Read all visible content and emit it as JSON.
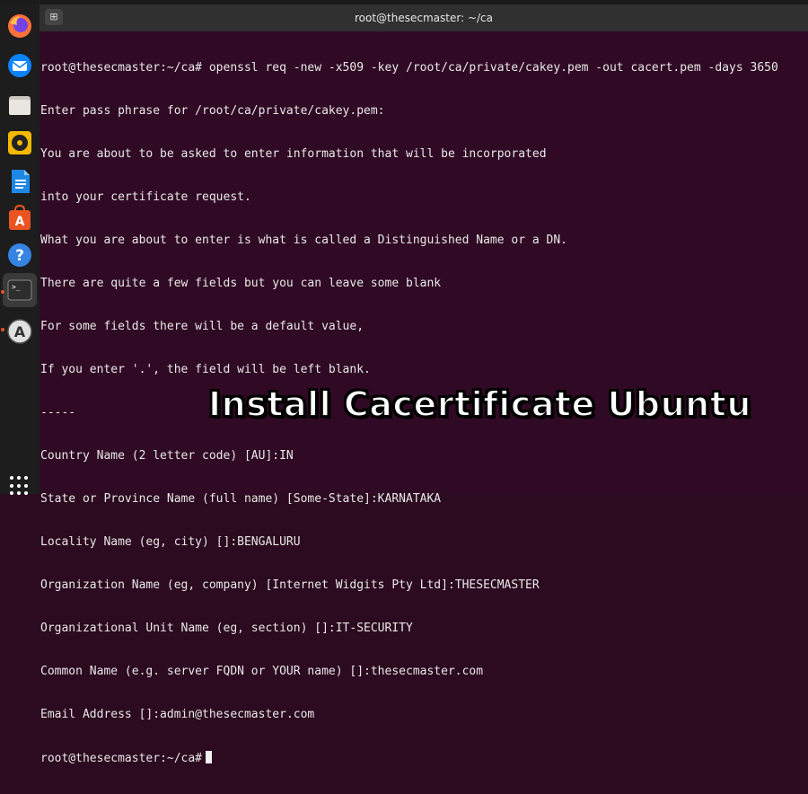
{
  "window": {
    "title": "root@thesecmaster: ~/ca",
    "new_tab_icon": "new-tab-icon"
  },
  "dock": {
    "items": [
      {
        "name": "firefox",
        "icon": "firefox-icon"
      },
      {
        "name": "thunderbird",
        "icon": "mail-icon"
      },
      {
        "name": "files",
        "icon": "folder-icon"
      },
      {
        "name": "rhythmbox",
        "icon": "music-icon"
      },
      {
        "name": "libreoffice-writer",
        "icon": "document-icon"
      },
      {
        "name": "software",
        "icon": "store-icon"
      },
      {
        "name": "help",
        "icon": "help-icon"
      },
      {
        "name": "terminal",
        "icon": "terminal-icon"
      },
      {
        "name": "updater",
        "icon": "update-icon"
      }
    ],
    "apps_grid_icon": "show-apps-icon",
    "accent_color": "#e95420"
  },
  "terminal": {
    "background": "#300a24",
    "lines": [
      "root@thesecmaster:~/ca# openssl req -new -x509 -key /root/ca/private/cakey.pem -out cacert.pem -days 3650",
      "Enter pass phrase for /root/ca/private/cakey.pem:",
      "You are about to be asked to enter information that will be incorporated",
      "into your certificate request.",
      "What you are about to enter is what is called a Distinguished Name or a DN.",
      "There are quite a few fields but you can leave some blank",
      "For some fields there will be a default value,",
      "If you enter '.', the field will be left blank.",
      "-----",
      "Country Name (2 letter code) [AU]:IN",
      "State or Province Name (full name) [Some-State]:KARNATAKA",
      "Locality Name (eg, city) []:BENGALURU",
      "Organization Name (eg, company) [Internet Widgits Pty Ltd]:THESECMASTER",
      "Organizational Unit Name (eg, section) []:IT-SECURITY",
      "Common Name (e.g. server FQDN or YOUR name) []:thesecmaster.com",
      "Email Address []:admin@thesecmaster.com"
    ],
    "prompt": "root@thesecmaster:~/ca#"
  },
  "caption": "Install Cacertificate Ubuntu"
}
